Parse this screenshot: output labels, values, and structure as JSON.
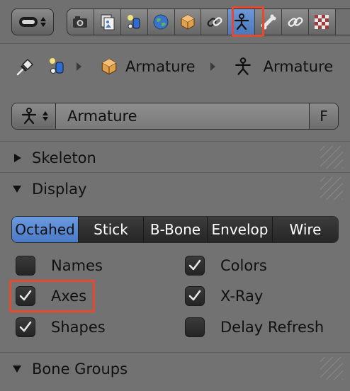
{
  "toolbar": {
    "editor_type_icon": "properties-editor-icon",
    "tabs": [
      {
        "icon": "camera-icon",
        "label": "Render"
      },
      {
        "icon": "render-layers-icon",
        "label": "Render Layers"
      },
      {
        "icon": "scene-icon",
        "label": "Scene"
      },
      {
        "icon": "world-icon",
        "label": "World"
      },
      {
        "icon": "object-icon",
        "label": "Object"
      },
      {
        "icon": "constraints-icon",
        "label": "Object Constraints"
      },
      {
        "icon": "armature-data-icon",
        "label": "Armature Data",
        "active": true
      },
      {
        "icon": "bone-icon",
        "label": "Bone"
      },
      {
        "icon": "bone-constraints-icon",
        "label": "Bone Constraints"
      },
      {
        "icon": "texture-icon",
        "label": "Texture"
      }
    ]
  },
  "breadcrumb": {
    "object_name": "Armature",
    "data_name": "Armature"
  },
  "datablock": {
    "name": "Armature",
    "fake_user": "F"
  },
  "panels": {
    "skeleton": "Skeleton",
    "display": "Display",
    "bone_groups": "Bone Groups"
  },
  "display": {
    "modes": [
      "Octahed",
      "Stick",
      "B-Bone",
      "Envelop",
      "Wire"
    ],
    "active_mode": "Octahed",
    "options": {
      "names": {
        "label": "Names",
        "checked": false
      },
      "colors": {
        "label": "Colors",
        "checked": true
      },
      "axes": {
        "label": "Axes",
        "checked": true
      },
      "xray": {
        "label": "X-Ray",
        "checked": true
      },
      "shapes": {
        "label": "Shapes",
        "checked": true
      },
      "delay_refresh": {
        "label": "Delay Refresh",
        "checked": false
      }
    }
  },
  "colors": {
    "accent_blue": "#5a88d0",
    "highlight_red": "#e34a2f",
    "panel_bg": "#727272"
  }
}
